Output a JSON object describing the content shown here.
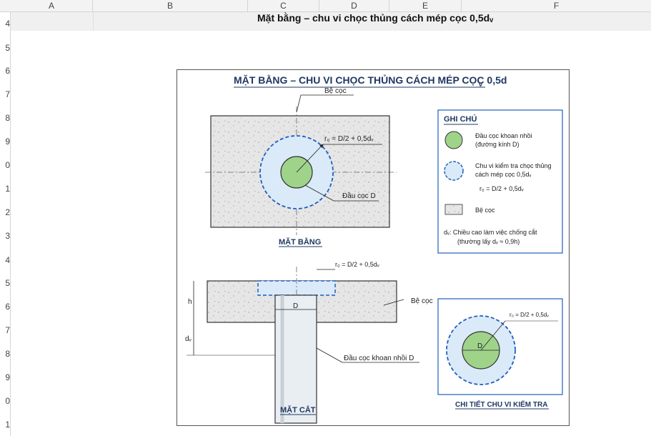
{
  "columns": [
    "A",
    "B",
    "C",
    "D",
    "E",
    "F"
  ],
  "rows": [
    "4",
    "5",
    "6",
    "7",
    "8",
    "9",
    "0",
    "1",
    "2",
    "3",
    "4",
    "5",
    "6",
    "7",
    "8",
    "9",
    "0",
    "1"
  ],
  "sheet_title": "Mặt bằng – chu vi chọc thủng cách mép cọc 0,5dᵥ",
  "diagram": {
    "title": "MẶT BẰNG – CHU VI CHỌC THỦNG CÁCH MÉP CỌC 0,5d",
    "title_sub": "v",
    "plan": {
      "be_coc_label": "Bệ cọc",
      "r0_label": "r₀ = D/2 + 0,5dᵥ",
      "pile_head_label": "Đầu cọc D",
      "caption": "MẶT BẰNG"
    },
    "legend": {
      "title": "GHI CHÚ",
      "item1_line1": "Đầu cọc khoan nhồi",
      "item1_line2": "(đường kính D)",
      "item2_line1": "Chu vi kiểm tra chọc thủng",
      "item2_line2": "cách mép cọc 0,5dᵥ",
      "item2_line3": "r₀ = D/2 + 0,5dᵥ",
      "item3": "Bệ cọc",
      "note_line1": "dᵥ:  Chiều cao làm việc chống cắt",
      "note_line2": "(thường lấy dᵥ ≈ 0,9h)"
    },
    "section": {
      "r0_label": "r₀ = D/2 + 0,5dᵥ",
      "h_label": "h",
      "dv_label": "dᵥ",
      "d_label": "D",
      "be_coc_label": "Bệ cọc",
      "pile_label": "Đầu cọc khoan nhồi D",
      "caption": "MẶT CẮT"
    },
    "detail": {
      "r0_label": "r₀ = D/2 + 0,5dᵥ",
      "d_label": "D",
      "caption": "CHI TIẾT CHU VI KIỂM TRA"
    }
  },
  "colors": {
    "title_blue": "#1f3864",
    "dash_blue": "#1f5fbf",
    "zone_fill": "#dbeaf8",
    "pile_green": "#9fd38a",
    "concrete": "#e6e6e6"
  }
}
